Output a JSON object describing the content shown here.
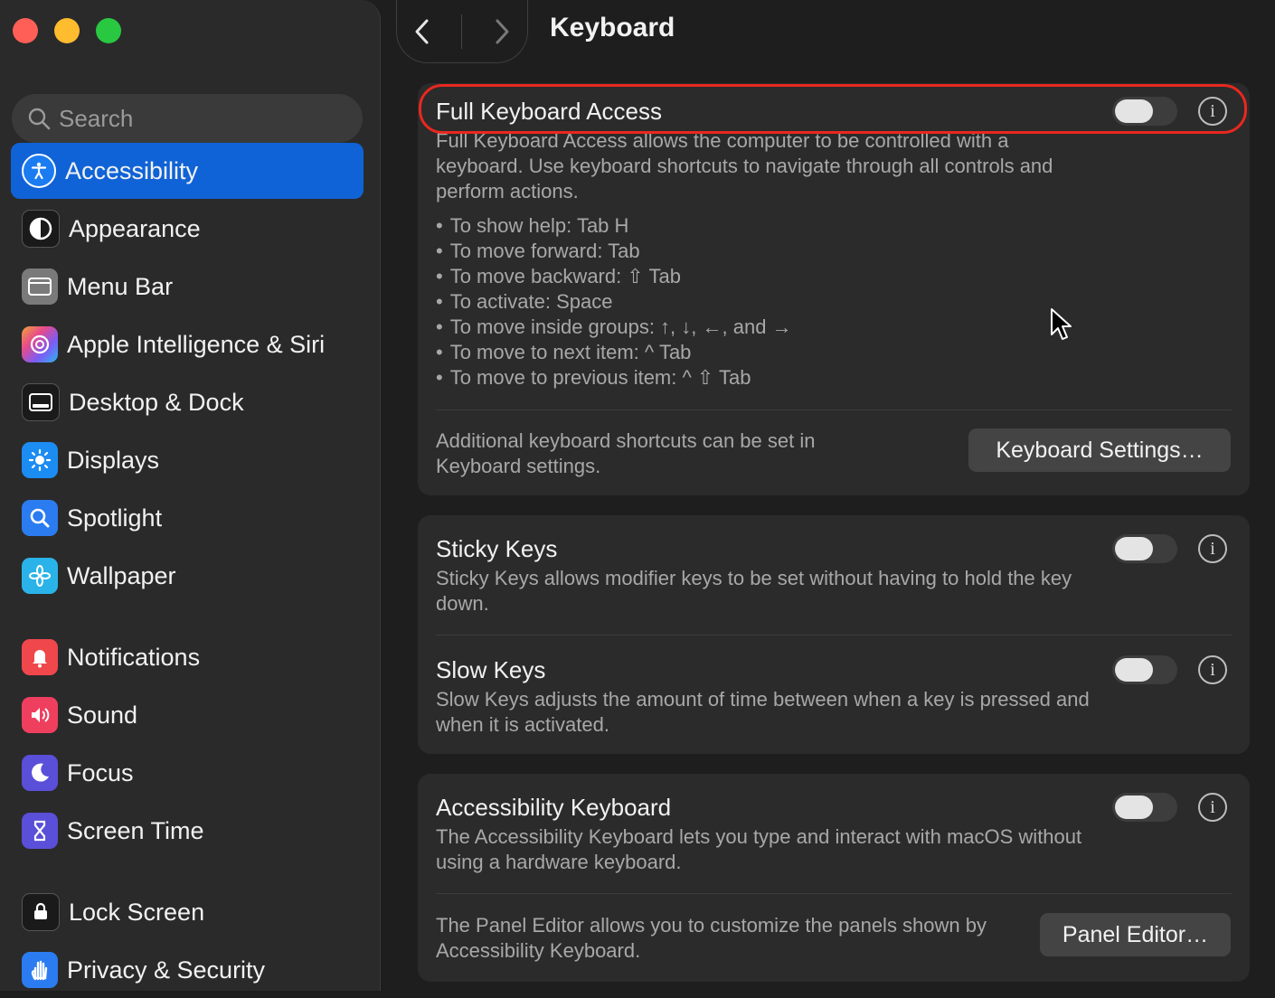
{
  "window": {
    "title": "Keyboard"
  },
  "sidebar": {
    "search_placeholder": "Search",
    "items": [
      {
        "label": "Accessibility",
        "icon": "accessibility-icon",
        "color": "#1b7cf2",
        "active": true
      },
      {
        "label": "Appearance",
        "icon": "appearance-icon",
        "color": "#1a1a1a"
      },
      {
        "label": "Menu Bar",
        "icon": "menu-bar-icon",
        "color": "#7a7a7a"
      },
      {
        "label": "Apple Intelligence & Siri",
        "icon": "siri-icon",
        "color": "#c05bd8"
      },
      {
        "label": "Desktop & Dock",
        "icon": "desktop-dock-icon",
        "color": "#1a1a1a"
      },
      {
        "label": "Displays",
        "icon": "displays-icon",
        "color": "#1b8cf2"
      },
      {
        "label": "Spotlight",
        "icon": "spotlight-icon",
        "color": "#2b7cf0"
      },
      {
        "label": "Wallpaper",
        "icon": "wallpaper-icon",
        "color": "#2ab3e8"
      },
      {
        "label": "Notifications",
        "icon": "notifications-icon",
        "color": "#f0474c"
      },
      {
        "label": "Sound",
        "icon": "sound-icon",
        "color": "#ef3f5f"
      },
      {
        "label": "Focus",
        "icon": "focus-icon",
        "color": "#5a4fd8"
      },
      {
        "label": "Screen Time",
        "icon": "screen-time-icon",
        "color": "#5a4fd8"
      },
      {
        "label": "Lock Screen",
        "icon": "lock-screen-icon",
        "color": "#1a1a1a"
      },
      {
        "label": "Privacy & Security",
        "icon": "privacy-security-icon",
        "color": "#2b7cf0"
      }
    ]
  },
  "full_keyboard_access": {
    "title": "Full Keyboard Access",
    "enabled": false,
    "description": "Full Keyboard Access allows the computer to be controlled with a keyboard. Use keyboard shortcuts to navigate through all controls and perform actions.",
    "shortcuts": [
      "To show help: Tab H",
      "To move forward: Tab",
      "To move backward: ⇧ Tab",
      "To activate: Space",
      "To move inside groups: ↑, ↓, ←, and →",
      "To move to next item: ^ Tab",
      "To move to previous item: ^ ⇧ Tab"
    ],
    "footer_text": "Additional keyboard shortcuts can be set in Keyboard settings.",
    "button_label": "Keyboard Settings…"
  },
  "sticky_keys": {
    "title": "Sticky Keys",
    "enabled": false,
    "description": "Sticky Keys allows modifier keys to be set without having to hold the key down."
  },
  "slow_keys": {
    "title": "Slow Keys",
    "enabled": false,
    "description": "Slow Keys adjusts the amount of time between when a key is pressed and when it is activated."
  },
  "accessibility_keyboard": {
    "title": "Accessibility Keyboard",
    "enabled": false,
    "description": "The Accessibility Keyboard lets you type and interact with macOS without using a hardware keyboard.",
    "footer_text": "The Panel Editor allows you to customize the panels shown by Accessibility Keyboard.",
    "button_label": "Panel Editor…"
  },
  "colors": {
    "accent": "#1063d6",
    "highlight_ring": "#e8281f"
  }
}
